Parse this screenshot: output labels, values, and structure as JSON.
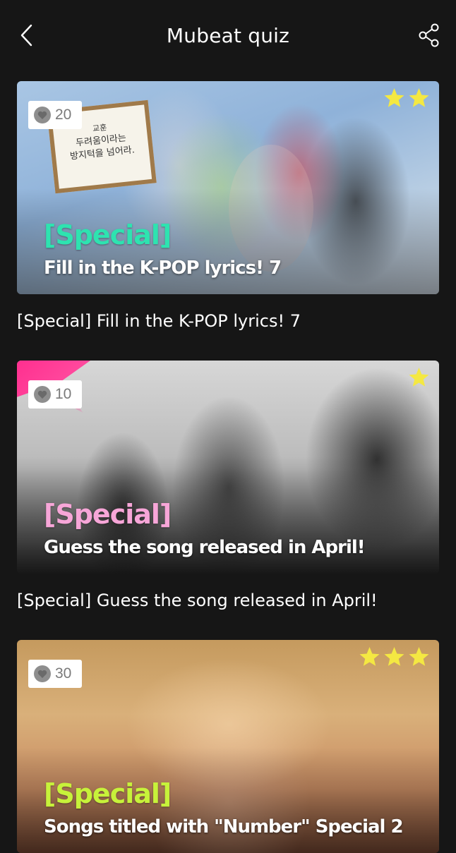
{
  "header": {
    "title": "Mubeat quiz"
  },
  "quizzes": [
    {
      "likes": "20",
      "stars": 2,
      "tag": "[Special]",
      "tag_color": "#2ee3b0",
      "overlay_title": "Fill in the K-POP lyrics! 7",
      "caption": "[Special] Fill in the K-POP lyrics! 7",
      "sign_lines": [
        "교훈",
        "두려움이라는",
        "방지턱을 넘어라."
      ]
    },
    {
      "likes": "10",
      "stars": 1,
      "tag": "[Special]",
      "tag_color": "#f7a6d8",
      "overlay_title": "Guess the song released in April!",
      "caption": "[Special] Guess the song released in April!"
    },
    {
      "likes": "30",
      "stars": 3,
      "tag": "[Special]",
      "tag_color": "#c7f23a",
      "overlay_title": "Songs titled with \"Number\" Special 2",
      "caption": ""
    }
  ],
  "colors": {
    "background": "#161616",
    "star": "#f4e842",
    "badge_bg": "#ffffff",
    "badge_heart": "#8e8e8e"
  },
  "icons": {
    "back": "chevron-left-icon",
    "share": "share-icon",
    "like": "heart-icon",
    "rating": "star-icon"
  }
}
